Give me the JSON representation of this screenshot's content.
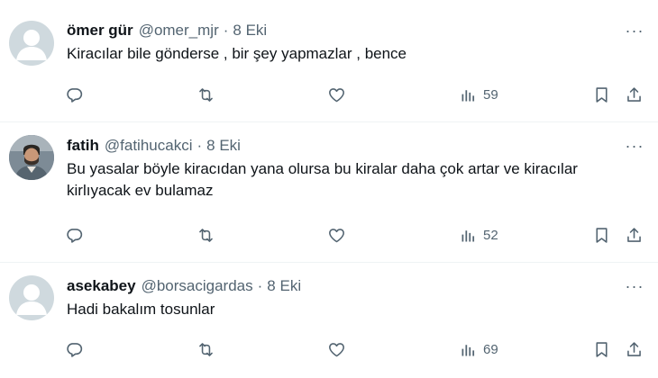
{
  "tweets": [
    {
      "name": "ömer gür",
      "handle": "@omer_mjr",
      "separator": "·",
      "time": "8 Eki",
      "text": "Kiracılar bile gönderse , bir şey yapmazlar , bence",
      "views": "59",
      "more": "···",
      "avatar": "default-avatar"
    },
    {
      "name": "fatih",
      "handle": "@fatihucakci",
      "separator": "·",
      "time": "8 Eki",
      "text": "Bu yasalar böyle kiracıdan yana olursa bu kiralar daha çok artar ve kiracılar kirlıyacak ev bulamaz",
      "views": "52",
      "more": "···",
      "avatar": "photo-avatar"
    },
    {
      "name": "asekabey",
      "handle": "@borsacigardas",
      "separator": "·",
      "time": "8 Eki",
      "text": "Hadi bakalım tosunlar",
      "views": "69",
      "more": "···",
      "avatar": "default-avatar"
    }
  ],
  "icons": {
    "reply": "reply-icon",
    "retweet": "retweet-icon",
    "like": "heart-icon",
    "views": "views-icon",
    "bookmark": "bookmark-icon",
    "share": "share-icon",
    "more": "more-icon"
  },
  "colors": {
    "text": "#0f1419",
    "secondary": "#536471",
    "divider": "#eff3f4",
    "default_avatar": "#cfd9de"
  }
}
